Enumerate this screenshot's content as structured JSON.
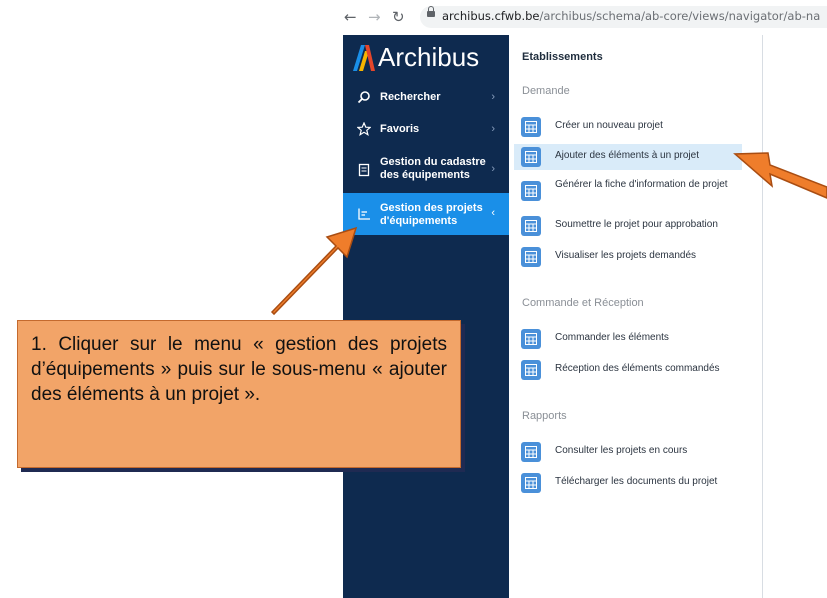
{
  "browser": {
    "back_icon": "arrow-left-icon",
    "forward_icon": "arrow-right-icon",
    "reload_icon": "reload-icon",
    "url_host": "archibus.cfwb.be",
    "url_path": "/archibus/schema/ab-core/views/navigator/ab-na"
  },
  "app": {
    "brand": "Archibus"
  },
  "sidebar": {
    "items": [
      {
        "label": "Rechercher",
        "icon": "search-icon"
      },
      {
        "label": "Favoris",
        "icon": "star-icon"
      },
      {
        "label_line1": "Gestion du cadastre",
        "label_line2": "des équipements",
        "icon": "clipboard-icon"
      },
      {
        "label_line1": "Gestion des projets",
        "label_line2": "d'équipements",
        "icon": "chart-icon",
        "active": true
      }
    ]
  },
  "main": {
    "title": "Etablissements",
    "sections": [
      {
        "heading": "Demande",
        "items": [
          {
            "label": "Créer un nouveau projet"
          },
          {
            "label": "Ajouter des éléments à un projet",
            "highlighted": true
          },
          {
            "label": "Générer la fiche d'information de projet"
          },
          {
            "label": "Soumettre le projet pour approbation"
          },
          {
            "label": "Visualiser les projets demandés"
          }
        ]
      },
      {
        "heading": "Commande et Réception",
        "items": [
          {
            "label": "Commander les éléments"
          },
          {
            "label": "Réception des éléments commandés"
          }
        ]
      },
      {
        "heading": "Rapports",
        "items": [
          {
            "label": "Consulter les projets en cours"
          },
          {
            "label": "Télécharger les documents du projet"
          }
        ]
      }
    ]
  },
  "annotation": {
    "text": "1. Cliquer sur le menu « gestion des projets d’équipements » puis sur le sous-menu « ajouter des éléments à un projet »."
  },
  "colors": {
    "sidebar_bg": "#0e2a4f",
    "active_item": "#1a8fe8",
    "highlight_row": "#d9ebf9",
    "tile": "#4a90d9",
    "callout": "#f2a468",
    "arrow": "#ef7d2b"
  }
}
